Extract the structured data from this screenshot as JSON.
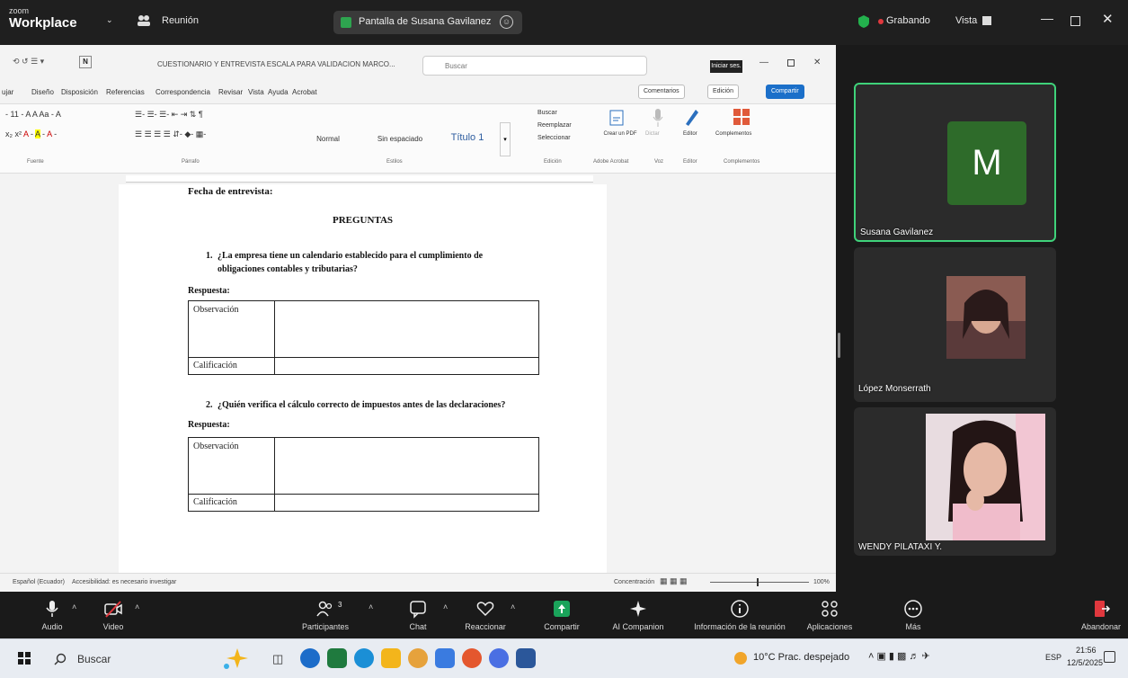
{
  "zoom": {
    "logo_small": "zoom",
    "logo_big": "Workplace",
    "meeting_label": "Reunión",
    "share_label": "Pantalla de Susana Gavilanez",
    "recording_label": "Grabando",
    "view_label": "Vista"
  },
  "word": {
    "filename": "CUESTIONARIO Y ENTREVISTA ESCALA PARA VALIDACION MARCO...",
    "search_placeholder": "Buscar",
    "badge": "Iniciar ses.",
    "tabs": [
      "ujar",
      "Diseño",
      "Disposición",
      "Referencias",
      "Correspondencia",
      "Revisar",
      "Vista",
      "Ayuda",
      "Acrobat"
    ],
    "btn_comments": "Comentarios",
    "btn_edit": "Edición",
    "btn_share": "Compartir",
    "styles": [
      "Normal",
      "Sin espaciado",
      "Título 1"
    ],
    "ribbon_groups": [
      "Fuente",
      "Párrafo",
      "Estilos",
      "Edición",
      "Adobe Acrobat",
      "Voz",
      "Editor",
      "Complementos"
    ],
    "ribbon_actions": [
      "Buscar",
      "Reemplazar",
      "Seleccionar",
      "Crear un PDF",
      "Dictar",
      "Editor",
      "Complementos"
    ],
    "status_left": "Español (Ecuador)",
    "status_access": "Accesibilidad: es necesario investigar",
    "status_focus": "Concentración",
    "zoom_level": "100%"
  },
  "document": {
    "date_label": "Fecha de entrevista:",
    "heading": "PREGUNTAS",
    "q1_num": "1.",
    "q1_line1": "¿La empresa tiene un calendario establecido para el cumplimiento de",
    "q1_line2": "obligaciones contables y tributarias?",
    "answer_label": "Respuesta:",
    "obs_label": "Observación",
    "grade_label": "Calificación",
    "q2_num": "2.",
    "q2_text": "¿Quién verifica el cálculo correcto de impuestos antes de las declaraciones?"
  },
  "participants": [
    {
      "name": "Susana Gavilanez",
      "initial": "M",
      "color": "#2e6b2a"
    },
    {
      "name": "López Monserrath"
    },
    {
      "name": "WENDY PILATAXI Y."
    }
  ],
  "toolbar": {
    "audio": "Audio",
    "video": "Video",
    "participants": "Participantes",
    "participants_count": "3",
    "chat": "Chat",
    "react": "Reaccionar",
    "share": "Compartir",
    "ai": "AI Companion",
    "info": "Información de la reunión",
    "apps": "Aplicaciones",
    "more": "Más",
    "leave": "Abandonar"
  },
  "taskbar": {
    "search": "Buscar",
    "weather": "10°C  Prac. despejado",
    "lang": "ESP",
    "time": "21:56",
    "date": "12/5/2025"
  }
}
